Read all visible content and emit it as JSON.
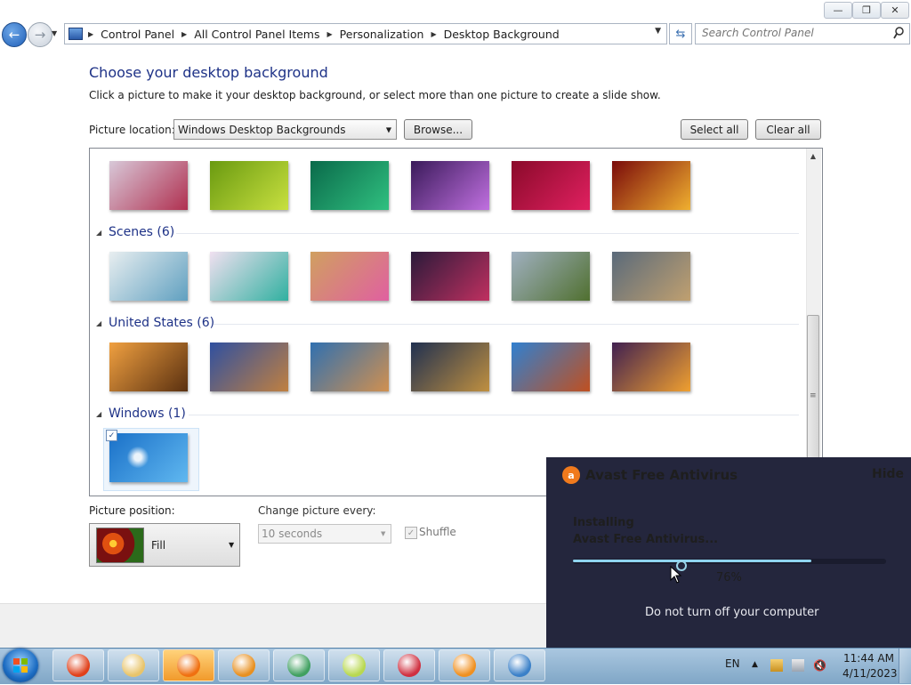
{
  "window": {
    "minimize_icon": "minimize-icon",
    "maximize_icon": "restore-icon",
    "close_icon": "close-icon"
  },
  "nav": {
    "breadcrumbs": [
      "Control Panel",
      "All Control Panel Items",
      "Personalization",
      "Desktop Background"
    ],
    "search_placeholder": "Search Control Panel"
  },
  "page": {
    "title": "Choose your desktop background",
    "subtitle": "Click a picture to make it your desktop background, or select more than one picture to create a slide show.",
    "picture_location_label": "Picture location:",
    "picture_location_value": "Windows Desktop Backgrounds",
    "browse_label": "Browse...",
    "select_all_label": "Select all",
    "clear_all_label": "Clear all"
  },
  "gallery": {
    "groups": [
      {
        "title": "",
        "thumb_colors": [
          [
            "#d8c8d8",
            "#b03050"
          ],
          [
            "#6a9a10",
            "#c8e040"
          ],
          [
            "#0a6a4a",
            "#30c080"
          ],
          [
            "#3a1a5a",
            "#c070e0"
          ],
          [
            "#8a0a2a",
            "#e02060"
          ],
          [
            "#7a0a0a",
            "#f0b030"
          ]
        ]
      },
      {
        "title": "Scenes (6)",
        "thumb_colors": [
          [
            "#e8eef0",
            "#60a0c0"
          ],
          [
            "#f0e0f0",
            "#30b0a0"
          ],
          [
            "#d0a060",
            "#e060a0"
          ],
          [
            "#2a1a3a",
            "#c03060"
          ],
          [
            "#a0b0c0",
            "#507030"
          ],
          [
            "#5a6a7a",
            "#c0a070"
          ]
        ]
      },
      {
        "title": "United States (6)",
        "thumb_colors": [
          [
            "#f0a040",
            "#5a3010"
          ],
          [
            "#3050a0",
            "#c08040"
          ],
          [
            "#3070b0",
            "#d09050"
          ],
          [
            "#203050",
            "#c09040"
          ],
          [
            "#3080d0",
            "#c05020"
          ],
          [
            "#402050",
            "#f0a030"
          ]
        ]
      },
      {
        "title": "Windows (1)",
        "thumb_colors": [
          [
            "#1a70c8",
            "#60b8f0"
          ]
        ]
      }
    ]
  },
  "bottom": {
    "picture_position_label": "Picture position:",
    "picture_position_value": "Fill",
    "change_every_label": "Change picture every:",
    "change_every_value": "10 seconds",
    "shuffle_label": "Shuffle",
    "shuffle_checked": true
  },
  "avast": {
    "title": "Avast Free Antivirus",
    "hide_label": "Hide",
    "status_line1": "Installing",
    "status_line2": "Avast Free Antivirus...",
    "progress_percent": 76,
    "progress_text": "76%",
    "note": "Do not turn off your computer",
    "accent": "#f07a1d",
    "progress_color": "#8fd4f0"
  },
  "taskbar": {
    "items": [
      {
        "name": "chrome",
        "icon": "chrome-icon",
        "color": "#e0401a"
      },
      {
        "name": "file-explorer",
        "icon": "folder-icon",
        "color": "#e8c46a"
      },
      {
        "name": "firefox",
        "icon": "firefox-icon",
        "color": "#f07010"
      },
      {
        "name": "search-tool",
        "icon": "magnifier-icon",
        "color": "#e89020"
      },
      {
        "name": "package-tool",
        "icon": "cubes-icon",
        "color": "#40a060"
      },
      {
        "name": "sticky-notes",
        "icon": "notes-icon",
        "color": "#b8d850"
      },
      {
        "name": "snipping-tool",
        "icon": "scissors-icon",
        "color": "#d03040"
      },
      {
        "name": "media-player",
        "icon": "media-icon",
        "color": "#f09020"
      },
      {
        "name": "control-panel",
        "icon": "control-panel-icon",
        "color": "#3a80c8"
      }
    ],
    "language": "EN",
    "clock_time": "11:44 AM",
    "clock_date": "4/11/2023"
  }
}
